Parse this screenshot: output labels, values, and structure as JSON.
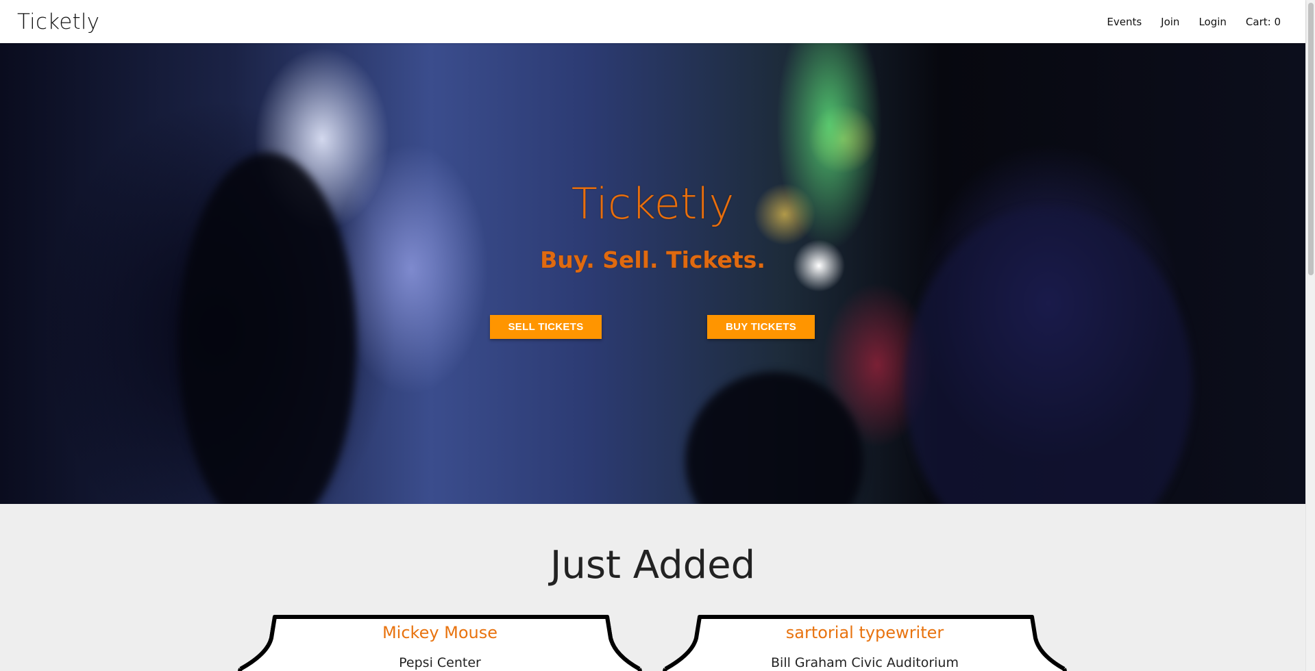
{
  "navbar": {
    "brand": "Ticketly",
    "links": [
      {
        "label": "Events"
      },
      {
        "label": "Join"
      },
      {
        "label": "Login"
      },
      {
        "label": "Cart: 0"
      }
    ]
  },
  "hero": {
    "title": "Ticketly",
    "subtitle": "Buy. Sell. Tickets.",
    "sell_button": "SELL TICKETS",
    "buy_button": "BUY TICKETS"
  },
  "just_added": {
    "heading": "Just Added",
    "tickets": [
      {
        "name": "Mickey Mouse",
        "venue": "Pepsi Center"
      },
      {
        "name": "sartorial typewriter",
        "venue": "Bill Graham Civic Auditorium"
      }
    ]
  },
  "colors": {
    "accent": "#ff9500",
    "title_orange": "#e86f0f",
    "page_bg": "#eeeeee"
  }
}
